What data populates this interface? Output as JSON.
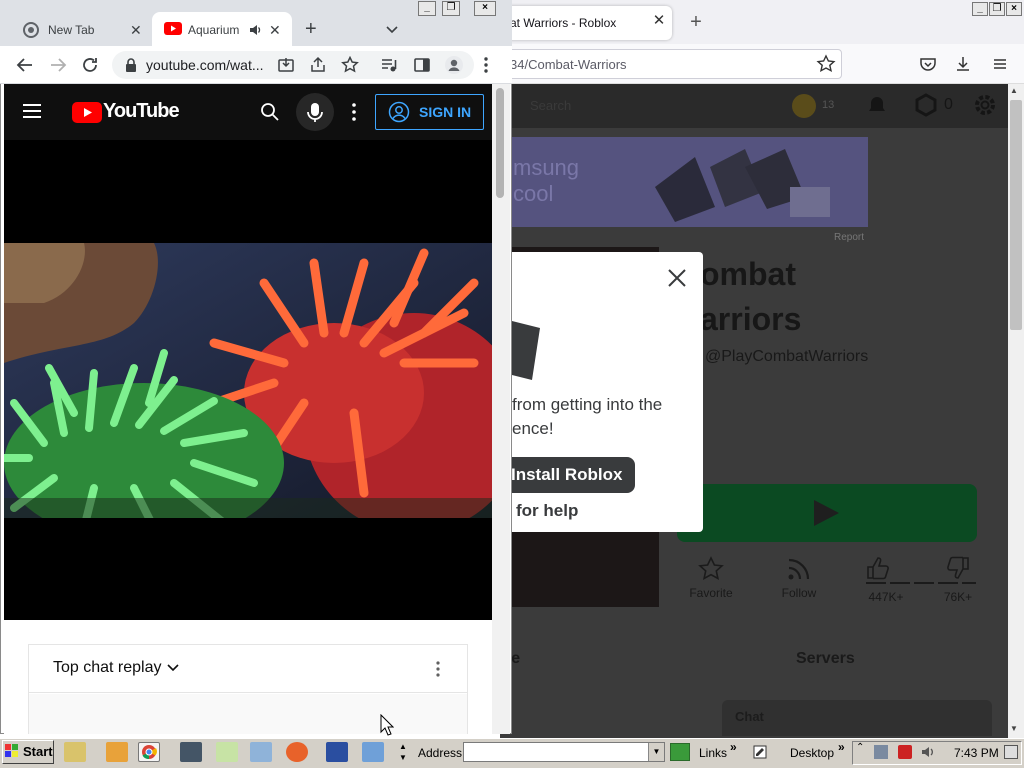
{
  "firefox": {
    "tab_title": "at Warriors - Roblox",
    "url_partial": "34/Combat-Warriors",
    "window_controls": [
      "_",
      "▫",
      "×"
    ]
  },
  "roblox": {
    "header_search": "Search",
    "robux_label": "13",
    "robux_count": "0",
    "banner_text": "msung\ncool",
    "report": "Report",
    "game_title_line1": "ombat",
    "game_title_line2": "arriors",
    "creator": "@PlayCombatWarriors",
    "favorite_label": "Favorite",
    "follow_label": "Follow",
    "likes": "447K+",
    "dislikes": "76K+",
    "servers_tab": "Servers",
    "about_tab_partial": "re",
    "chat_label": "Chat",
    "modal": {
      "text_line1": "from getting into the",
      "text_line2": "ence!",
      "install_button": "Install Roblox",
      "help_link": "for help"
    }
  },
  "chrome": {
    "tabs": [
      {
        "label": "New Tab"
      },
      {
        "label": "Aquarium"
      }
    ],
    "url": "youtube.com/wat..."
  },
  "youtube": {
    "logo_text": "YouTube",
    "sign_in": "SIGN IN",
    "chat_title": "Top chat replay"
  },
  "taskbar": {
    "start": "Start",
    "address_label": "Address",
    "address_value": "",
    "links": "Links",
    "desktop": "Desktop",
    "clock": "7:43 PM"
  },
  "colors": {
    "youtube_red": "#ff0000",
    "signin_blue": "#3ea6ff",
    "play_green": "#0b4a22"
  }
}
